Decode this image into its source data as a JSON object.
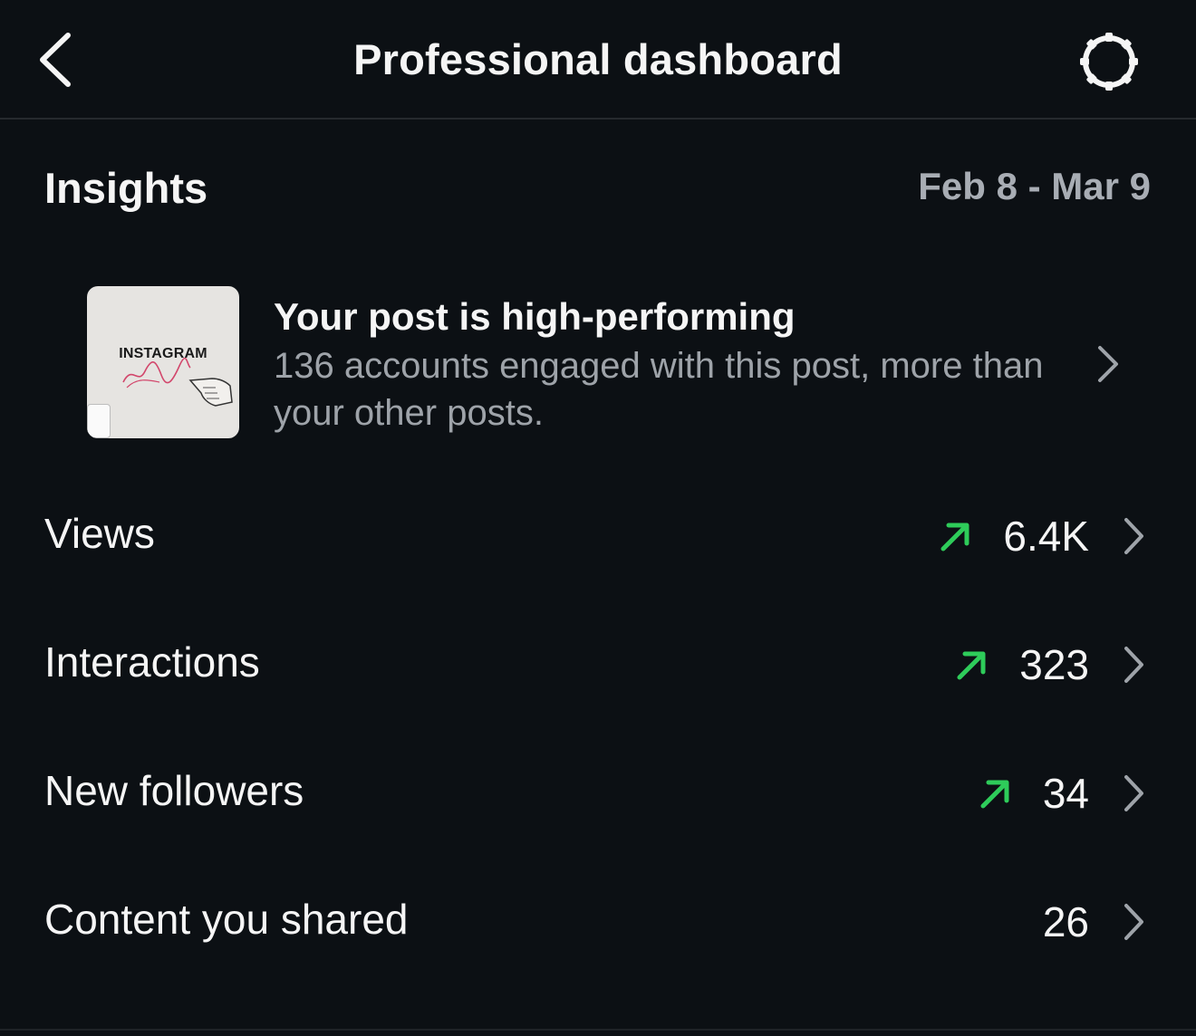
{
  "header": {
    "title": "Professional dashboard",
    "back_icon": "chevron-left-icon",
    "settings_icon": "gear-icon"
  },
  "insights": {
    "title": "Insights",
    "date_range": "Feb 8 - Mar 9"
  },
  "highlight": {
    "thumbnail_text": "INSTAGRAM",
    "title": "Your post is high-performing",
    "description": "136 accounts engaged with this post, more than your other posts."
  },
  "metrics": [
    {
      "label": "Views",
      "value": "6.4K",
      "trend": "up"
    },
    {
      "label": "Interactions",
      "value": "323",
      "trend": "up"
    },
    {
      "label": "New followers",
      "value": "34",
      "trend": "up"
    },
    {
      "label": "Content you shared",
      "value": "26",
      "trend": "none"
    }
  ],
  "colors": {
    "background": "#0c1014",
    "text_primary": "#f5f5f5",
    "text_secondary": "#a8adb4",
    "trend_up": "#2ecc5a",
    "chevron": "#9ea3a9"
  }
}
